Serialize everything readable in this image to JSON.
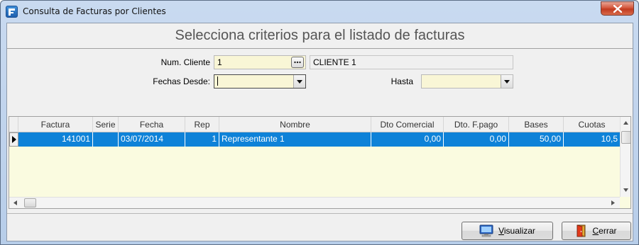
{
  "window": {
    "title": "Consulta de Facturas por Clientes"
  },
  "header": {
    "title": "Selecciona criterios para el listado de facturas"
  },
  "form": {
    "client_label": "Num. Cliente",
    "client_value": "1",
    "client_name": "CLIENTE 1",
    "from_label": "Fechas Desde:",
    "from_value": "",
    "to_label": "Hasta",
    "to_value": ""
  },
  "table": {
    "columns": [
      "Factura",
      "Serie",
      "Fecha",
      "Rep",
      "Nombre",
      "Dto Comercial",
      "Dto. F.pago",
      "Bases",
      "Cuotas"
    ],
    "rows": [
      [
        "141001",
        "",
        "03/07/2014",
        "1",
        "Representante 1",
        "0,00",
        "0,00",
        "50,00",
        "10,5"
      ]
    ]
  },
  "buttons": {
    "visualizar_first": "V",
    "visualizar_rest": "isualizar",
    "cerrar_first": "C",
    "cerrar_rest": "errar"
  },
  "colors": {
    "selection": "#0e82d8",
    "input_bg": "#f9f6d6",
    "grid_bg": "#fafbe0"
  }
}
